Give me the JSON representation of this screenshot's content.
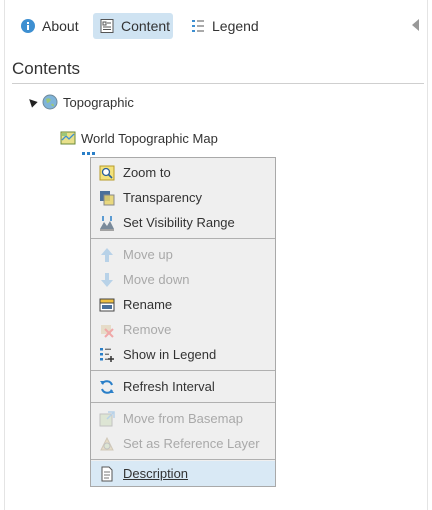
{
  "tabs": [
    {
      "label": "About"
    },
    {
      "label": "Content"
    },
    {
      "label": "Legend"
    }
  ],
  "heading": "Contents",
  "tree": {
    "basemap_label": "Topographic",
    "layer_label": "World Topographic Map"
  },
  "menu": {
    "items": [
      {
        "label": "Zoom to",
        "icon": "zoom-to-icon"
      },
      {
        "label": "Transparency",
        "icon": "transparency-icon"
      },
      {
        "label": "Set Visibility Range",
        "icon": "visibility-range-icon"
      },
      {
        "label": "Move up",
        "icon": "arrow-up-icon",
        "disabled": true
      },
      {
        "label": "Move down",
        "icon": "arrow-down-icon",
        "disabled": true
      },
      {
        "label": "Rename",
        "icon": "rename-icon"
      },
      {
        "label": "Remove",
        "icon": "remove-icon",
        "disabled": true
      },
      {
        "label": "Show in Legend",
        "icon": "legend-icon"
      },
      {
        "label": "Refresh Interval",
        "icon": "refresh-icon"
      },
      {
        "label": "Move from Basemap",
        "icon": "move-basemap-icon",
        "disabled": true
      },
      {
        "label": "Set as Reference Layer",
        "icon": "reference-layer-icon",
        "disabled": true
      },
      {
        "label": "Description",
        "icon": "description-icon",
        "highlighted": true
      }
    ]
  },
  "colors": {
    "accent": "#2a7fc8",
    "active_tab_bg": "#cfe3f2",
    "menu_bg": "#efefef",
    "disabled_text": "#a9a9a9"
  }
}
